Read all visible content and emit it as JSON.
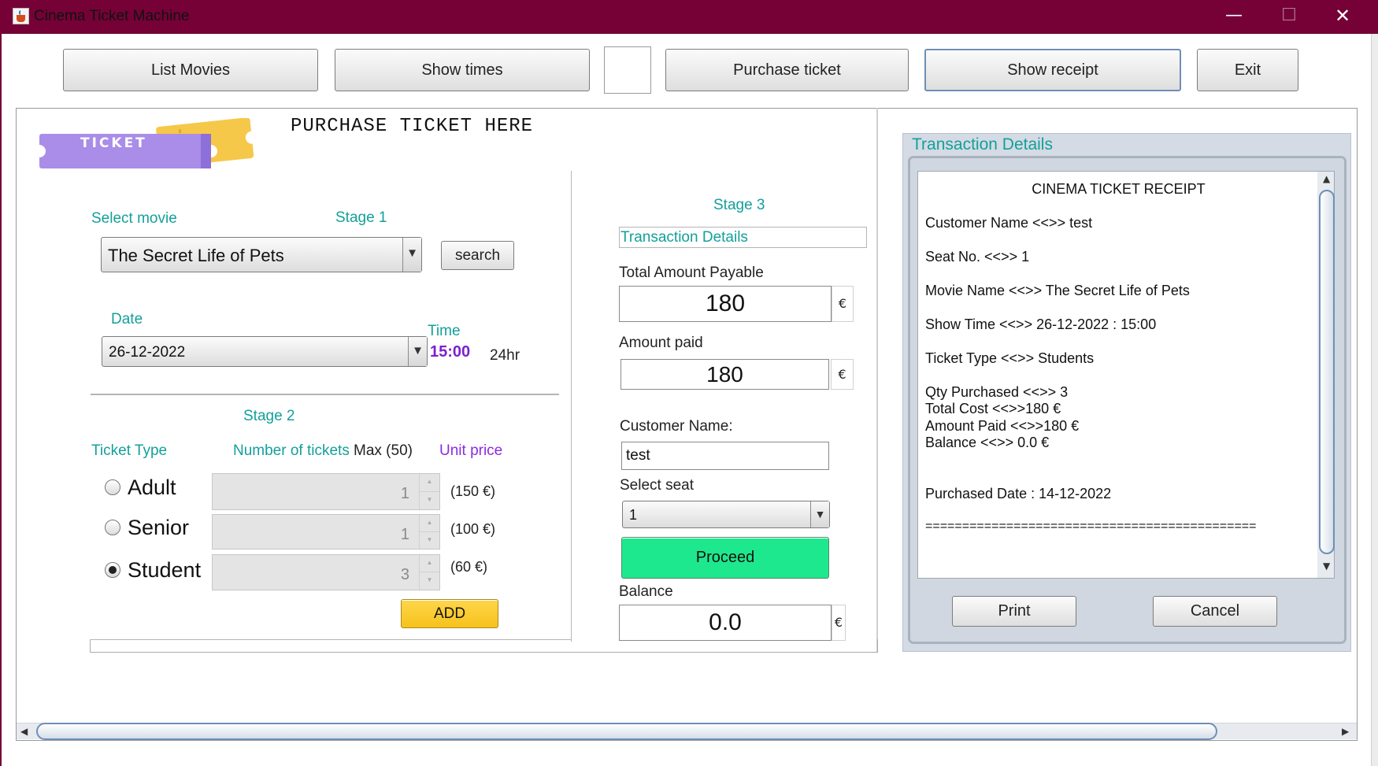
{
  "window": {
    "title": "Cinema Ticket Machine",
    "min_glyph": "—",
    "max_glyph": "☐",
    "close_glyph": "✕",
    "icon": "java-cup-icon"
  },
  "toolbar": {
    "list_movies": "List Movies",
    "show_times": "Show times",
    "purchase_ticket": "Purchase ticket",
    "show_receipt": "Show receipt",
    "exit": "Exit"
  },
  "purchase": {
    "logo_text": "TICKET",
    "heading": "PURCHASE TICKET HERE"
  },
  "stage1": {
    "select_movie_label": "Select movie",
    "stage_label": "Stage 1",
    "movie_value": "The Secret Life of Pets",
    "search_button": "search",
    "date_label": "Date",
    "date_value": "26-12-2022",
    "time_label": "Time",
    "time_value": "15:00",
    "time_unit": "24hr"
  },
  "stage2": {
    "stage_label": "Stage 2",
    "ticket_type_label": "Ticket Type",
    "num_tickets_label": "Number of tickets",
    "max_label": "Max (50)",
    "unit_price_label": "Unit price",
    "rows": [
      {
        "type": "Adult",
        "qty": "1",
        "price": "(150 €)",
        "selected": false
      },
      {
        "type": "Senior",
        "qty": "1",
        "price": "(100 €)",
        "selected": false
      },
      {
        "type": "Student",
        "qty": "3",
        "price": "(60 €)",
        "selected": true
      }
    ],
    "add_button": "ADD"
  },
  "stage3": {
    "stage_label": "Stage 3",
    "transaction_details_label": "Transaction  Details",
    "total_payable_label": "Total Amount Payable",
    "total_payable_value": "180",
    "amount_paid_label": "Amount paid",
    "amount_paid_value": "180",
    "currency": "€",
    "customer_name_label": "Customer Name:",
    "customer_name_value": "test",
    "select_seat_label": "Select seat",
    "seat_value": "1",
    "proceed_button": "Proceed",
    "balance_label": "Balance",
    "balance_value": "0.0"
  },
  "transaction": {
    "title": "Transaction Details",
    "receipt_lines": [
      "CINEMA TICKET RECEIPT",
      "Customer Name <<>> test",
      "Seat No. <<>> 1",
      "Movie Name <<>> The Secret Life of Pets",
      "Show Time <<>> 26-12-2022 : 15:00",
      "Ticket Type <<>> Students",
      "Qty Purchased <<>> 3",
      "Total Cost <<>>180 €",
      "Amount Paid <<>>180 €",
      "Balance <<>> 0.0 €",
      "Purchased Date : 14-12-2022",
      "============================================="
    ],
    "print_button": "Print",
    "cancel_button": "Cancel"
  }
}
